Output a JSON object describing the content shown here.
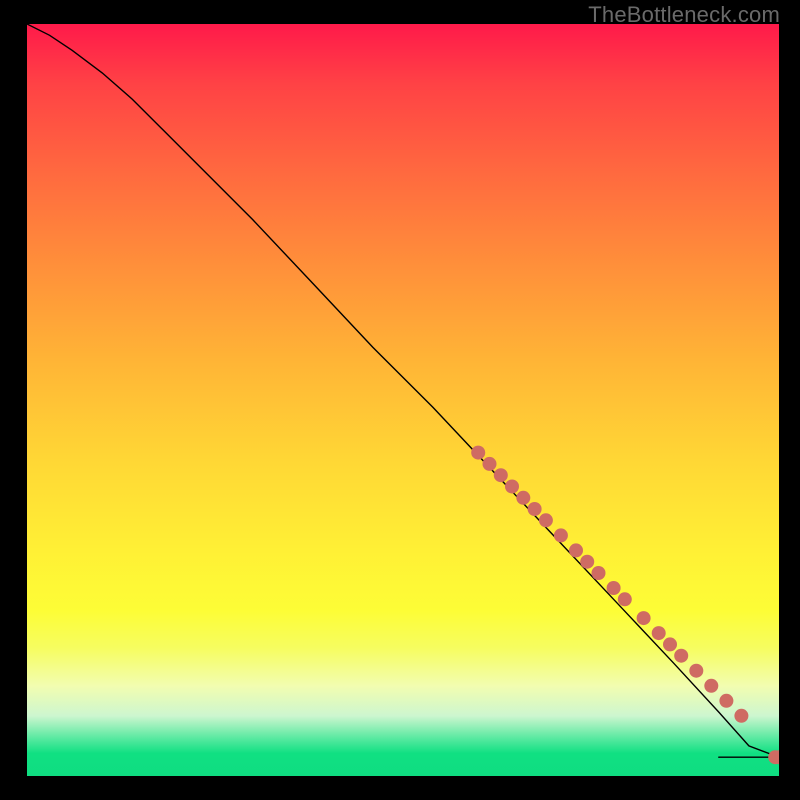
{
  "watermark": "TheBottleneck.com",
  "chart_data": {
    "type": "line",
    "title": "",
    "xlabel": "",
    "ylabel": "",
    "xlim": [
      0,
      100
    ],
    "ylim": [
      0,
      100
    ],
    "grid": false,
    "axis_visible": false,
    "background_gradient": [
      "#ff1a4a",
      "#ff6a3f",
      "#ffb536",
      "#fdfd36",
      "#0fdd81"
    ],
    "series": [
      {
        "name": "curve",
        "stroke": "#000000",
        "stroke_width": 1.4,
        "x": [
          0,
          3,
          6,
          10,
          14,
          18,
          24,
          30,
          38,
          46,
          54,
          62,
          70,
          78,
          86,
          92,
          96,
          100
        ],
        "y": [
          100,
          98.5,
          96.5,
          93.5,
          90,
          86,
          80,
          74,
          65.5,
          57,
          49,
          40.5,
          32,
          23.5,
          15,
          8.5,
          4,
          2.5
        ]
      },
      {
        "name": "flat-tail",
        "stroke": "#000000",
        "stroke_width": 1.4,
        "x": [
          92,
          100
        ],
        "y": [
          2.5,
          2.5
        ]
      }
    ],
    "markers": {
      "name": "highlight-points",
      "fill": "#cf6b63",
      "radius": 7,
      "x": [
        60,
        61.5,
        63,
        64.5,
        66,
        67.5,
        69,
        71,
        73,
        74.5,
        76,
        78,
        79.5,
        82,
        84,
        85.5,
        87,
        89,
        91,
        93,
        95,
        99.5,
        100
      ],
      "y": [
        43,
        41.5,
        40,
        38.5,
        37,
        35.5,
        34,
        32,
        30,
        28.5,
        27,
        25,
        23.5,
        21,
        19,
        17.5,
        16,
        14,
        12,
        10,
        8,
        2.5,
        2.5
      ]
    }
  }
}
